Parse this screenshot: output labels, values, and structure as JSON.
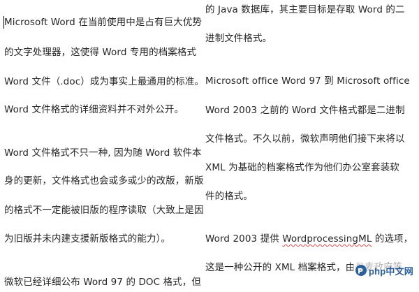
{
  "left_column": [
    "Microsoft Word 在当前使用中是占有巨大优势",
    "的文字处理器，这使得 Word 专用的档案格式",
    "Word  文件（.doc）成为事实上最通用的标准。",
    "Word 文件格式的详细资料并不对外公开。",
    "Word 文件格式不只一种, 因为随 Word 软件本",
    "身的更新，文件格式也会或多或少的改版，新版",
    "的格式不一定能被旧版的程序读取（大致上是因",
    "为旧版并未内建支援新版格式的能力）。",
    "微软已经详细公布 Word 97 的 DOC 格式，但"
  ],
  "right_column": [
    "的 Java 数据库，其主要目标是存取 Word 的二",
    "进制文件格式。",
    "Microsoft office Word 97 到 Microsoft office",
    "Word 2003 之前的 Word 文件格式都是二进制",
    "文件格式。不久以前，微软声明他们接下来将以",
    "XML 为基础的档案格式作为他们办公室套装软",
    "件的格式。",
    {
      "before": "Word 2003 提供 ",
      "squiggled": "WordprocessingML",
      "after": " 的选项，"
    },
    "这是一种公开的 XML 档案格式，由丹麦政府等"
  ],
  "watermark": {
    "text": "php中文网",
    "icon": "php-logo-icon",
    "color": "#2d5f9a"
  },
  "colors": {
    "text": "#262626",
    "spellcheck_squiggle": "#e04a4a"
  }
}
